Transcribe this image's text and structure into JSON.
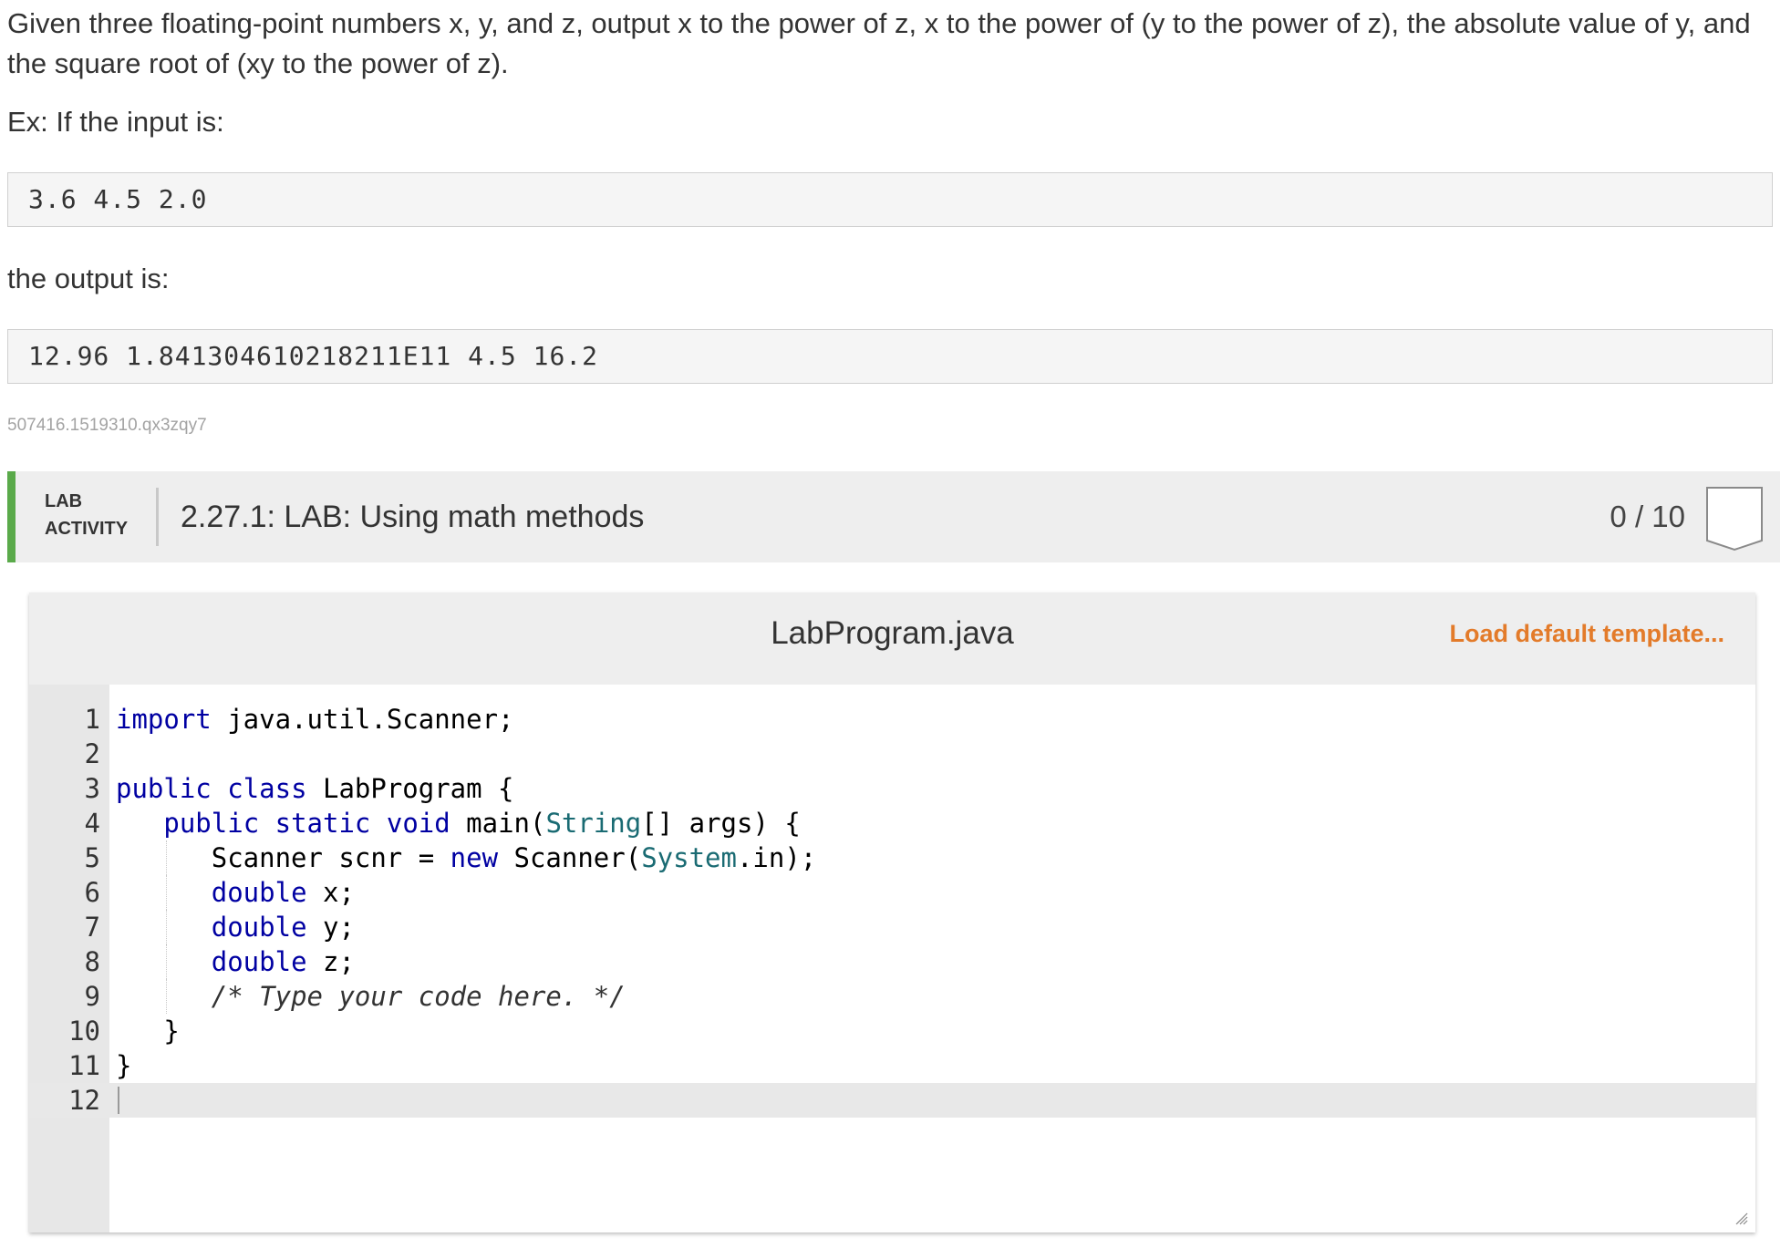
{
  "prompt": {
    "text": "Given three floating-point numbers x, y, and z, output x to the power of z, x to the power of (y to the power of z), the absolute value of y, and the square root of (xy to the power of z).",
    "example_label": "Ex: If the input is:",
    "example_input": "3.6 4.5 2.0",
    "output_label": "the output is:",
    "example_output": "12.96 1.841304610218211E11 4.5 16.2",
    "id_code": "507416.1519310.qx3zqy7"
  },
  "lab": {
    "tag_line1": "LAB",
    "tag_line2": "ACTIVITY",
    "title": "2.27.1: LAB: Using math methods",
    "score": "0 / 10",
    "accent_color": "#5aaa4a"
  },
  "editor": {
    "file_name": "LabProgram.java",
    "load_template_label": "Load default template...",
    "load_template_color": "#e37b2a",
    "lines": [
      {
        "n": "1",
        "t": [
          [
            "kw",
            "import"
          ],
          [
            "pl",
            " java.util.Scanner;"
          ]
        ]
      },
      {
        "n": "2",
        "t": []
      },
      {
        "n": "3",
        "t": [
          [
            "kw",
            "public"
          ],
          [
            "pl",
            " "
          ],
          [
            "kw",
            "class"
          ],
          [
            "pl",
            " LabProgram {"
          ]
        ]
      },
      {
        "n": "4",
        "t": [
          [
            "pl",
            "   "
          ],
          [
            "kw",
            "public"
          ],
          [
            "pl",
            " "
          ],
          [
            "kw",
            "static"
          ],
          [
            "pl",
            " "
          ],
          [
            "kw",
            "void"
          ],
          [
            "pl",
            " main("
          ],
          [
            "ty",
            "String"
          ],
          [
            "pl",
            "[] args) {"
          ]
        ]
      },
      {
        "n": "5",
        "t": [
          [
            "pl",
            "      Scanner scnr = "
          ],
          [
            "kw",
            "new"
          ],
          [
            "pl",
            " Scanner("
          ],
          [
            "ty",
            "System"
          ],
          [
            "pl",
            ".in);"
          ]
        ]
      },
      {
        "n": "6",
        "t": [
          [
            "pl",
            "      "
          ],
          [
            "kw",
            "double"
          ],
          [
            "pl",
            " x;"
          ]
        ]
      },
      {
        "n": "7",
        "t": [
          [
            "pl",
            "      "
          ],
          [
            "kw",
            "double"
          ],
          [
            "pl",
            " y;"
          ]
        ]
      },
      {
        "n": "8",
        "t": [
          [
            "pl",
            "      "
          ],
          [
            "kw",
            "double"
          ],
          [
            "pl",
            " z;"
          ]
        ]
      },
      {
        "n": "9",
        "t": [
          [
            "pl",
            "      "
          ],
          [
            "cm",
            "/* Type your code here. */"
          ]
        ]
      },
      {
        "n": "10",
        "t": [
          [
            "pl",
            "   }"
          ]
        ]
      },
      {
        "n": "11",
        "t": [
          [
            "pl",
            "}"
          ]
        ]
      },
      {
        "n": "12",
        "t": []
      }
    ],
    "active_line": "12"
  }
}
